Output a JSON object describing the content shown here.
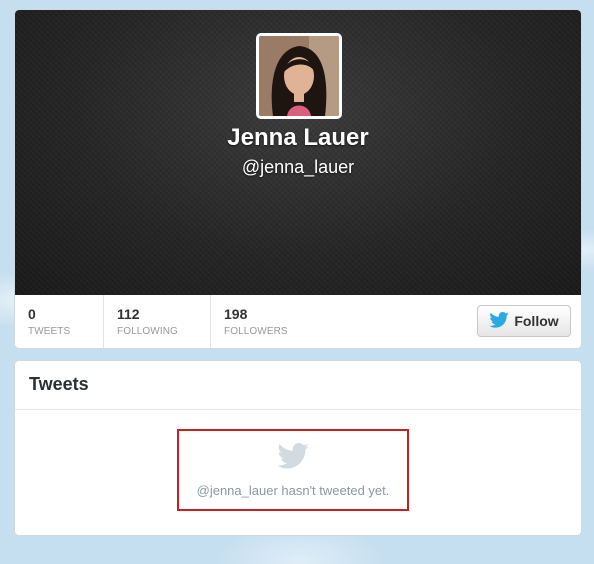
{
  "profile": {
    "name": "Jenna Lauer",
    "handle": "@jenna_lauer"
  },
  "stats": [
    {
      "value": "0",
      "label": "TWEETS"
    },
    {
      "value": "112",
      "label": "FOLLOWING"
    },
    {
      "value": "198",
      "label": "FOLLOWERS"
    }
  ],
  "follow_button": {
    "label": "Follow",
    "icon": "twitter-bird-icon",
    "icon_color": "#2ba9e1"
  },
  "tweets": {
    "title": "Tweets",
    "empty_message": "@jenna_lauer hasn't tweeted yet.",
    "empty_icon": "twitter-bird-icon",
    "highlight_color": "#cc1f1f"
  },
  "colors": {
    "header_background": "#262626",
    "page_background": "#c6dff0"
  }
}
